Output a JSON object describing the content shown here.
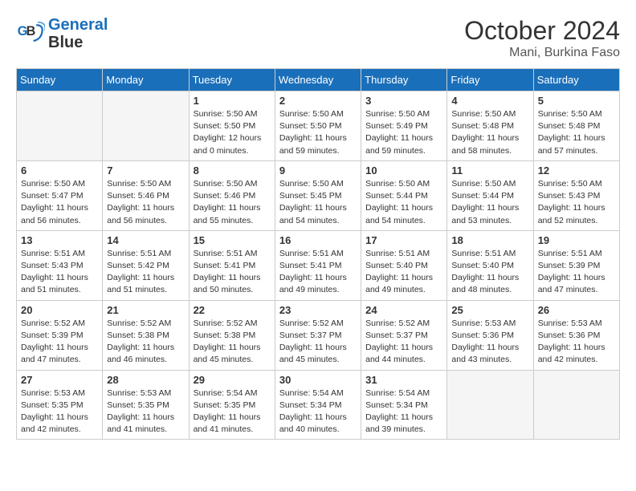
{
  "header": {
    "logo_line1": "General",
    "logo_line2": "Blue",
    "month": "October 2024",
    "location": "Mani, Burkina Faso"
  },
  "days_of_week": [
    "Sunday",
    "Monday",
    "Tuesday",
    "Wednesday",
    "Thursday",
    "Friday",
    "Saturday"
  ],
  "weeks": [
    [
      {
        "day": "",
        "info": ""
      },
      {
        "day": "",
        "info": ""
      },
      {
        "day": "1",
        "info": "Sunrise: 5:50 AM\nSunset: 5:50 PM\nDaylight: 12 hours\nand 0 minutes."
      },
      {
        "day": "2",
        "info": "Sunrise: 5:50 AM\nSunset: 5:50 PM\nDaylight: 11 hours\nand 59 minutes."
      },
      {
        "day": "3",
        "info": "Sunrise: 5:50 AM\nSunset: 5:49 PM\nDaylight: 11 hours\nand 59 minutes."
      },
      {
        "day": "4",
        "info": "Sunrise: 5:50 AM\nSunset: 5:48 PM\nDaylight: 11 hours\nand 58 minutes."
      },
      {
        "day": "5",
        "info": "Sunrise: 5:50 AM\nSunset: 5:48 PM\nDaylight: 11 hours\nand 57 minutes."
      }
    ],
    [
      {
        "day": "6",
        "info": "Sunrise: 5:50 AM\nSunset: 5:47 PM\nDaylight: 11 hours\nand 56 minutes."
      },
      {
        "day": "7",
        "info": "Sunrise: 5:50 AM\nSunset: 5:46 PM\nDaylight: 11 hours\nand 56 minutes."
      },
      {
        "day": "8",
        "info": "Sunrise: 5:50 AM\nSunset: 5:46 PM\nDaylight: 11 hours\nand 55 minutes."
      },
      {
        "day": "9",
        "info": "Sunrise: 5:50 AM\nSunset: 5:45 PM\nDaylight: 11 hours\nand 54 minutes."
      },
      {
        "day": "10",
        "info": "Sunrise: 5:50 AM\nSunset: 5:44 PM\nDaylight: 11 hours\nand 54 minutes."
      },
      {
        "day": "11",
        "info": "Sunrise: 5:50 AM\nSunset: 5:44 PM\nDaylight: 11 hours\nand 53 minutes."
      },
      {
        "day": "12",
        "info": "Sunrise: 5:50 AM\nSunset: 5:43 PM\nDaylight: 11 hours\nand 52 minutes."
      }
    ],
    [
      {
        "day": "13",
        "info": "Sunrise: 5:51 AM\nSunset: 5:43 PM\nDaylight: 11 hours\nand 51 minutes."
      },
      {
        "day": "14",
        "info": "Sunrise: 5:51 AM\nSunset: 5:42 PM\nDaylight: 11 hours\nand 51 minutes."
      },
      {
        "day": "15",
        "info": "Sunrise: 5:51 AM\nSunset: 5:41 PM\nDaylight: 11 hours\nand 50 minutes."
      },
      {
        "day": "16",
        "info": "Sunrise: 5:51 AM\nSunset: 5:41 PM\nDaylight: 11 hours\nand 49 minutes."
      },
      {
        "day": "17",
        "info": "Sunrise: 5:51 AM\nSunset: 5:40 PM\nDaylight: 11 hours\nand 49 minutes."
      },
      {
        "day": "18",
        "info": "Sunrise: 5:51 AM\nSunset: 5:40 PM\nDaylight: 11 hours\nand 48 minutes."
      },
      {
        "day": "19",
        "info": "Sunrise: 5:51 AM\nSunset: 5:39 PM\nDaylight: 11 hours\nand 47 minutes."
      }
    ],
    [
      {
        "day": "20",
        "info": "Sunrise: 5:52 AM\nSunset: 5:39 PM\nDaylight: 11 hours\nand 47 minutes."
      },
      {
        "day": "21",
        "info": "Sunrise: 5:52 AM\nSunset: 5:38 PM\nDaylight: 11 hours\nand 46 minutes."
      },
      {
        "day": "22",
        "info": "Sunrise: 5:52 AM\nSunset: 5:38 PM\nDaylight: 11 hours\nand 45 minutes."
      },
      {
        "day": "23",
        "info": "Sunrise: 5:52 AM\nSunset: 5:37 PM\nDaylight: 11 hours\nand 45 minutes."
      },
      {
        "day": "24",
        "info": "Sunrise: 5:52 AM\nSunset: 5:37 PM\nDaylight: 11 hours\nand 44 minutes."
      },
      {
        "day": "25",
        "info": "Sunrise: 5:53 AM\nSunset: 5:36 PM\nDaylight: 11 hours\nand 43 minutes."
      },
      {
        "day": "26",
        "info": "Sunrise: 5:53 AM\nSunset: 5:36 PM\nDaylight: 11 hours\nand 42 minutes."
      }
    ],
    [
      {
        "day": "27",
        "info": "Sunrise: 5:53 AM\nSunset: 5:35 PM\nDaylight: 11 hours\nand 42 minutes."
      },
      {
        "day": "28",
        "info": "Sunrise: 5:53 AM\nSunset: 5:35 PM\nDaylight: 11 hours\nand 41 minutes."
      },
      {
        "day": "29",
        "info": "Sunrise: 5:54 AM\nSunset: 5:35 PM\nDaylight: 11 hours\nand 41 minutes."
      },
      {
        "day": "30",
        "info": "Sunrise: 5:54 AM\nSunset: 5:34 PM\nDaylight: 11 hours\nand 40 minutes."
      },
      {
        "day": "31",
        "info": "Sunrise: 5:54 AM\nSunset: 5:34 PM\nDaylight: 11 hours\nand 39 minutes."
      },
      {
        "day": "",
        "info": ""
      },
      {
        "day": "",
        "info": ""
      }
    ]
  ]
}
